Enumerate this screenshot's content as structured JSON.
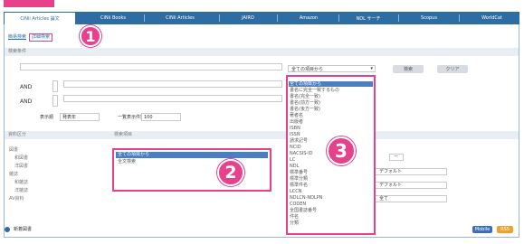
{
  "tabs": [
    {
      "label": "CiNii Articles 論文",
      "active": true
    },
    {
      "label": "CiNii Books",
      "active": false
    },
    {
      "label": "CiNii Articles",
      "active": false
    },
    {
      "label": "JAIRO",
      "active": false
    },
    {
      "label": "Amazon",
      "active": false
    },
    {
      "label": "NDL サーチ",
      "active": false
    },
    {
      "label": "Scopus",
      "active": false
    },
    {
      "label": "WorldCat",
      "active": false
    }
  ],
  "breadcrumb": {
    "simple": "簡易検索",
    "detail": "詳細検索"
  },
  "section": {
    "search_conditions": "検索条件",
    "search_target": "資料区分",
    "search_items": "検索項目"
  },
  "search": {
    "button": "検索",
    "clear": "クリア"
  },
  "operators": [
    "AND",
    "AND"
  ],
  "options": {
    "display_label": "表示順",
    "display_value": "発表年",
    "count_label": "一覧表示件数",
    "count_value": "100"
  },
  "dropdown": {
    "selected": "全ての項目から",
    "items": [
      "全ての項目から",
      "書名に完全一致するもの",
      "書名(完全一致)",
      "書名(前方一致)",
      "書名(後方一致)",
      "著者名",
      "出版者",
      "ISBN",
      "ISSN",
      "請求記号",
      "NCID",
      "NACSIS-ID",
      "LC",
      "NDL",
      "標準番号",
      "標準分類",
      "標準件名",
      "LCCN",
      "NDLCN-NDLPN",
      "CODEN",
      "全国書誌番号",
      "件名",
      "分類"
    ],
    "highlight_index": 0
  },
  "targets": [
    "図書",
    "和図書",
    "洋図書",
    "雑誌",
    "和雑誌",
    "洋雑誌",
    "AV資料"
  ],
  "search_items": [
    "全ての項目から",
    "全文検索"
  ],
  "right_fields": [
    "ー",
    "デフォルト",
    "デフォルト",
    "全て"
  ],
  "footer": {
    "note": "新着図書",
    "mobile": "Mobile",
    "rss": "RSS"
  },
  "callouts": [
    "1",
    "2",
    "3"
  ],
  "colors": {
    "tabbar": "#2e6da4",
    "callout": "#e8418b",
    "select_highlight": "#4a7fc1",
    "rss": "#f0a030"
  }
}
